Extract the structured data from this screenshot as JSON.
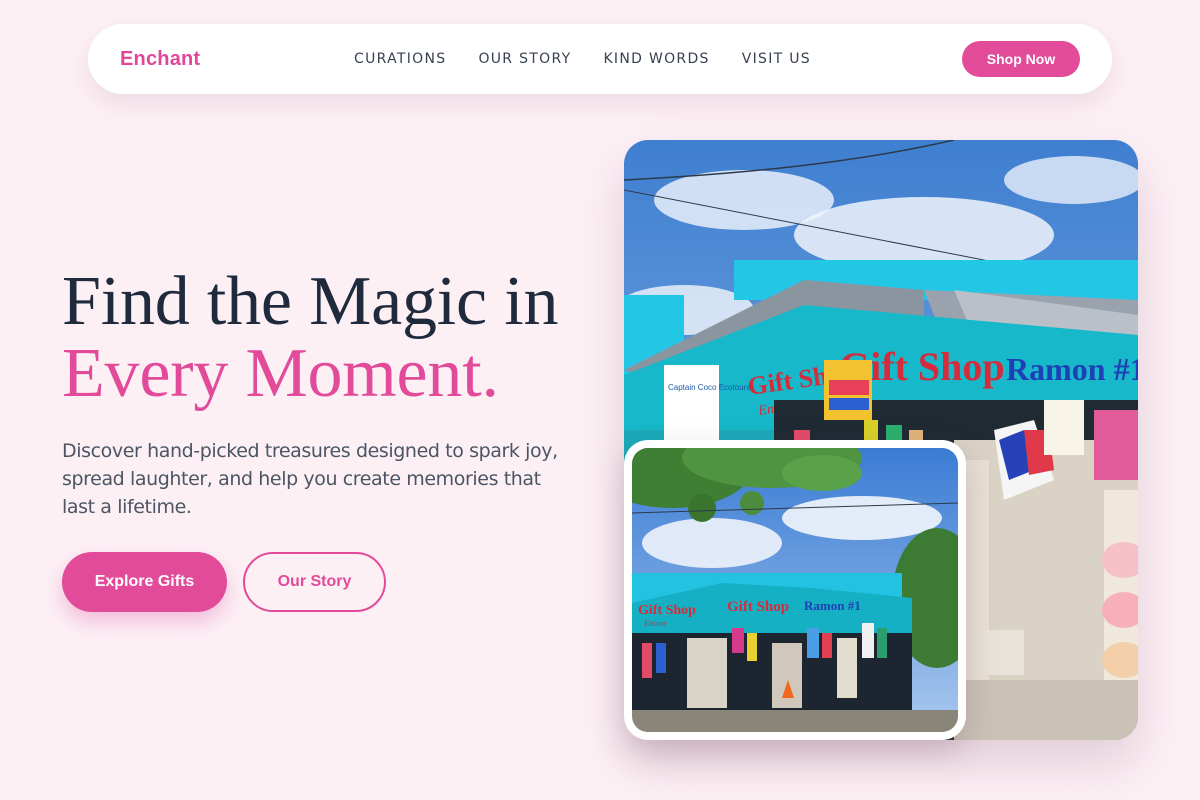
{
  "brand": {
    "name": "Enchant"
  },
  "nav": {
    "links": [
      "CURATIONS",
      "OUR STORY",
      "KIND WORDS",
      "VISIT US"
    ],
    "cta": "Shop Now"
  },
  "hero": {
    "title_line1": "Find the Magic in",
    "title_line2": "Every Moment.",
    "lead": "Discover hand-picked treasures designed to spark joy, spread laughter, and help you create memories that last a lifetime.",
    "primary_cta": "Explore Gifts",
    "secondary_cta": "Our Story"
  },
  "images": {
    "main": {
      "sign_left": "Gift Shop",
      "sign_sub": "Encore",
      "sign_mid": "Gift Shop",
      "sign_right": "Ramon #1",
      "side_sign": "Captain Coco Ecotours"
    },
    "inset": {
      "sign_left": "Gift Shop",
      "sign_sub": "Encore",
      "sign_mid": "Gift Shop",
      "sign_right": "Ramon #1"
    }
  },
  "colors": {
    "accent": "#e24a9a",
    "background": "#fcf0f5",
    "heading": "#1f2a3d",
    "body_text": "#4b5563"
  }
}
